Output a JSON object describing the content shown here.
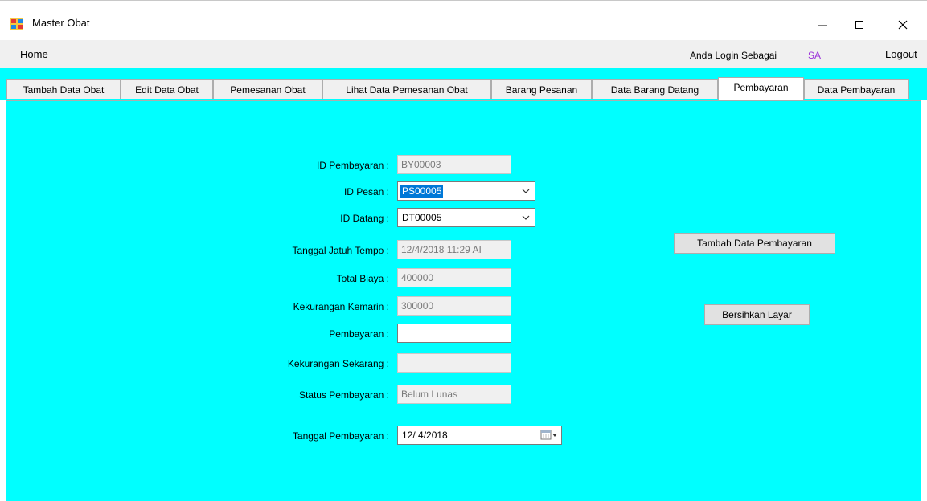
{
  "window": {
    "title": "Master Obat",
    "icon": "app-window-icon",
    "controls": [
      "minimize-icon",
      "maximize-icon",
      "close-icon"
    ]
  },
  "menubar": {
    "home": "Home",
    "login_label": "Anda Login Sebagai",
    "login_user": "SA",
    "logout": "Logout"
  },
  "tabs": [
    {
      "label": "Tambah Data Obat",
      "active": false
    },
    {
      "label": "Edit Data Obat",
      "active": false
    },
    {
      "label": "Pemesanan Obat",
      "active": false
    },
    {
      "label": "Lihat Data Pemesanan Obat",
      "active": false
    },
    {
      "label": "Barang Pesanan",
      "active": false
    },
    {
      "label": "Data Barang Datang",
      "active": false
    },
    {
      "label": "Pembayaran",
      "active": true
    },
    {
      "label": "Data Pembayaran",
      "active": false
    }
  ],
  "form": {
    "id_pembayaran": {
      "label": "ID Pembayaran :",
      "value": "BY00003"
    },
    "id_pesan": {
      "label": "ID Pesan :",
      "value": "PS00005"
    },
    "id_datang": {
      "label": "ID Datang :",
      "value": "DT00005"
    },
    "tanggal_jatuh_tempo": {
      "label": "Tanggal Jatuh Tempo :",
      "value": "12/4/2018 11:29 AI"
    },
    "total_biaya": {
      "label": "Total Biaya :",
      "value": "400000"
    },
    "kekurangan_kemarin": {
      "label": "Kekurangan Kemarin :",
      "value": "300000"
    },
    "pembayaran": {
      "label": "Pembayaran :",
      "value": ""
    },
    "kekurangan_sekarang": {
      "label": "Kekurangan Sekarang :",
      "value": ""
    },
    "status_pembayaran": {
      "label": "Status Pembayaran :",
      "value": "Belum Lunas"
    },
    "tanggal_pembayaran": {
      "label": "Tanggal Pembayaran :",
      "value": "12/  4/2018"
    }
  },
  "buttons": {
    "tambah": "Tambah Data Pembayaran",
    "bersihkan": "Bersihkan Layar"
  },
  "colors": {
    "panel_bg": "#00ffff",
    "login_user": "#9b30d9",
    "selection": "#0078d7"
  }
}
